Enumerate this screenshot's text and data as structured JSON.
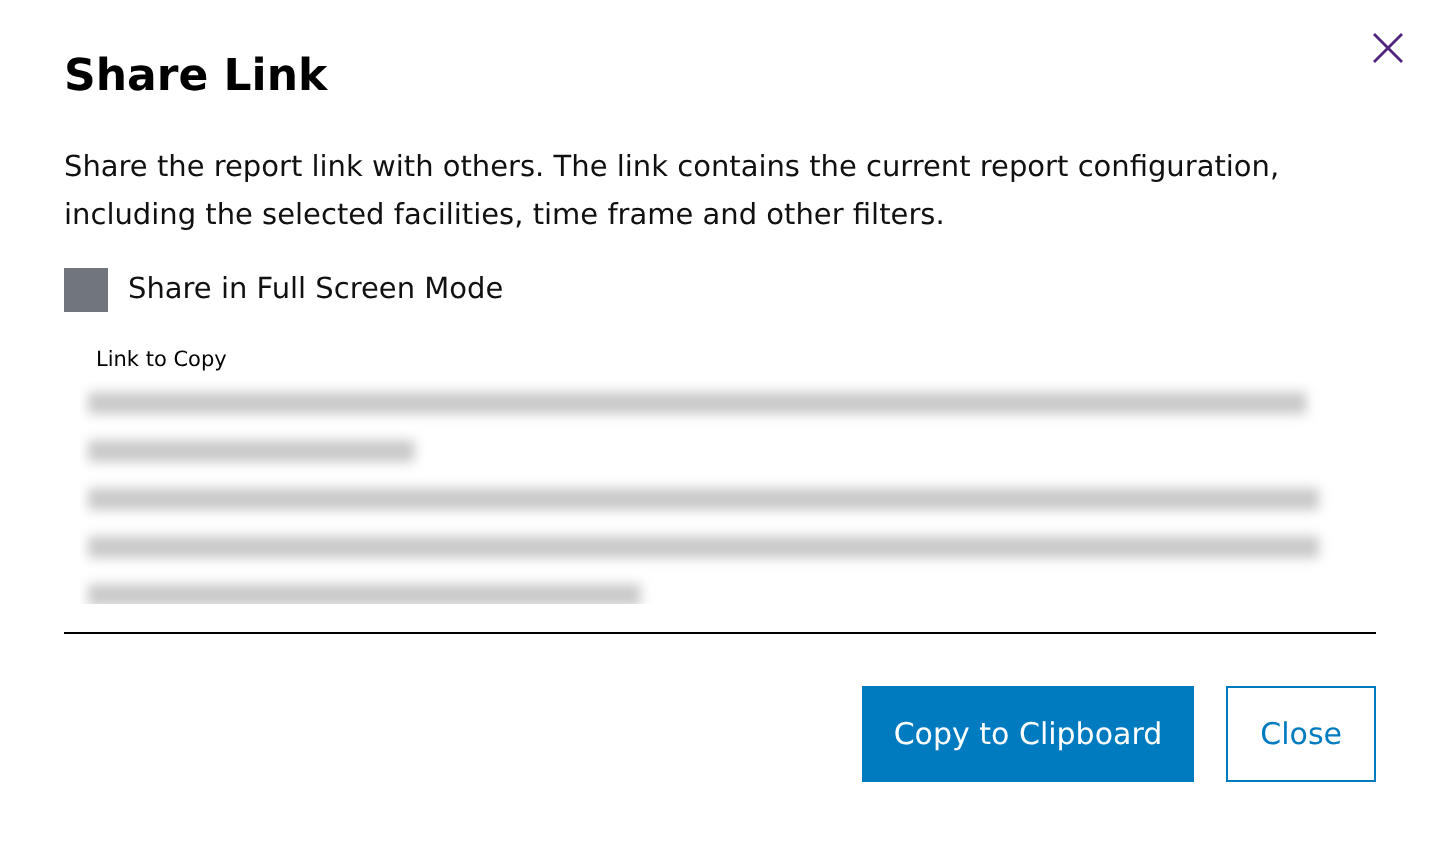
{
  "dialog": {
    "title": "Share Link",
    "description": "Share the report link with others. The link contains the current report configuration, including the selected facilities, time frame and other filters.",
    "full_screen_option": {
      "label": "Share in Full Screen Mode",
      "checked": false
    },
    "link_field": {
      "label": "Link to Copy"
    },
    "buttons": [
      {
        "label": "Copy to Clipboard",
        "kind": "primary"
      },
      {
        "label": "Close",
        "kind": "secondary"
      }
    ]
  }
}
